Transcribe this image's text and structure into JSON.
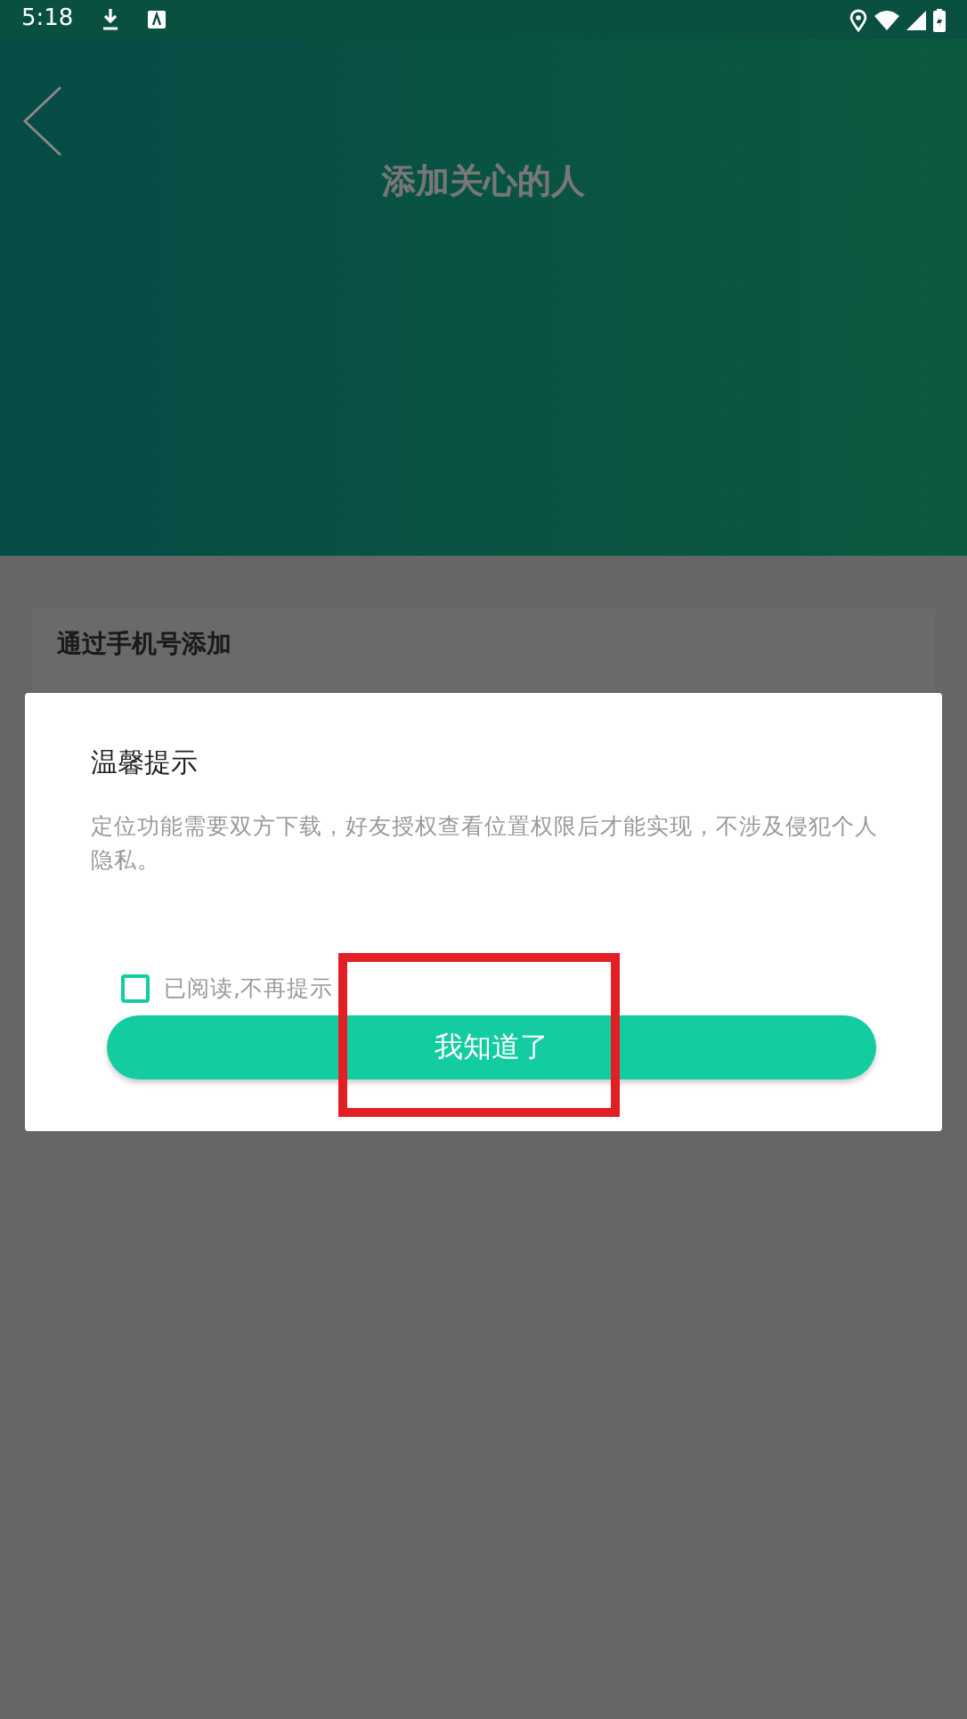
{
  "status_bar": {
    "time": "5:18"
  },
  "header": {
    "title": "添加关心的人"
  },
  "section": {
    "title": "通过手机号添加"
  },
  "dialog": {
    "title": "温馨提示",
    "message": "定位功能需要双方下载，好友授权查看位置权限后才能实现，不涉及侵犯个人隐私。",
    "checkbox": {
      "label": "已阅读,不再提示",
      "checked": false
    },
    "button": "我知道了"
  }
}
